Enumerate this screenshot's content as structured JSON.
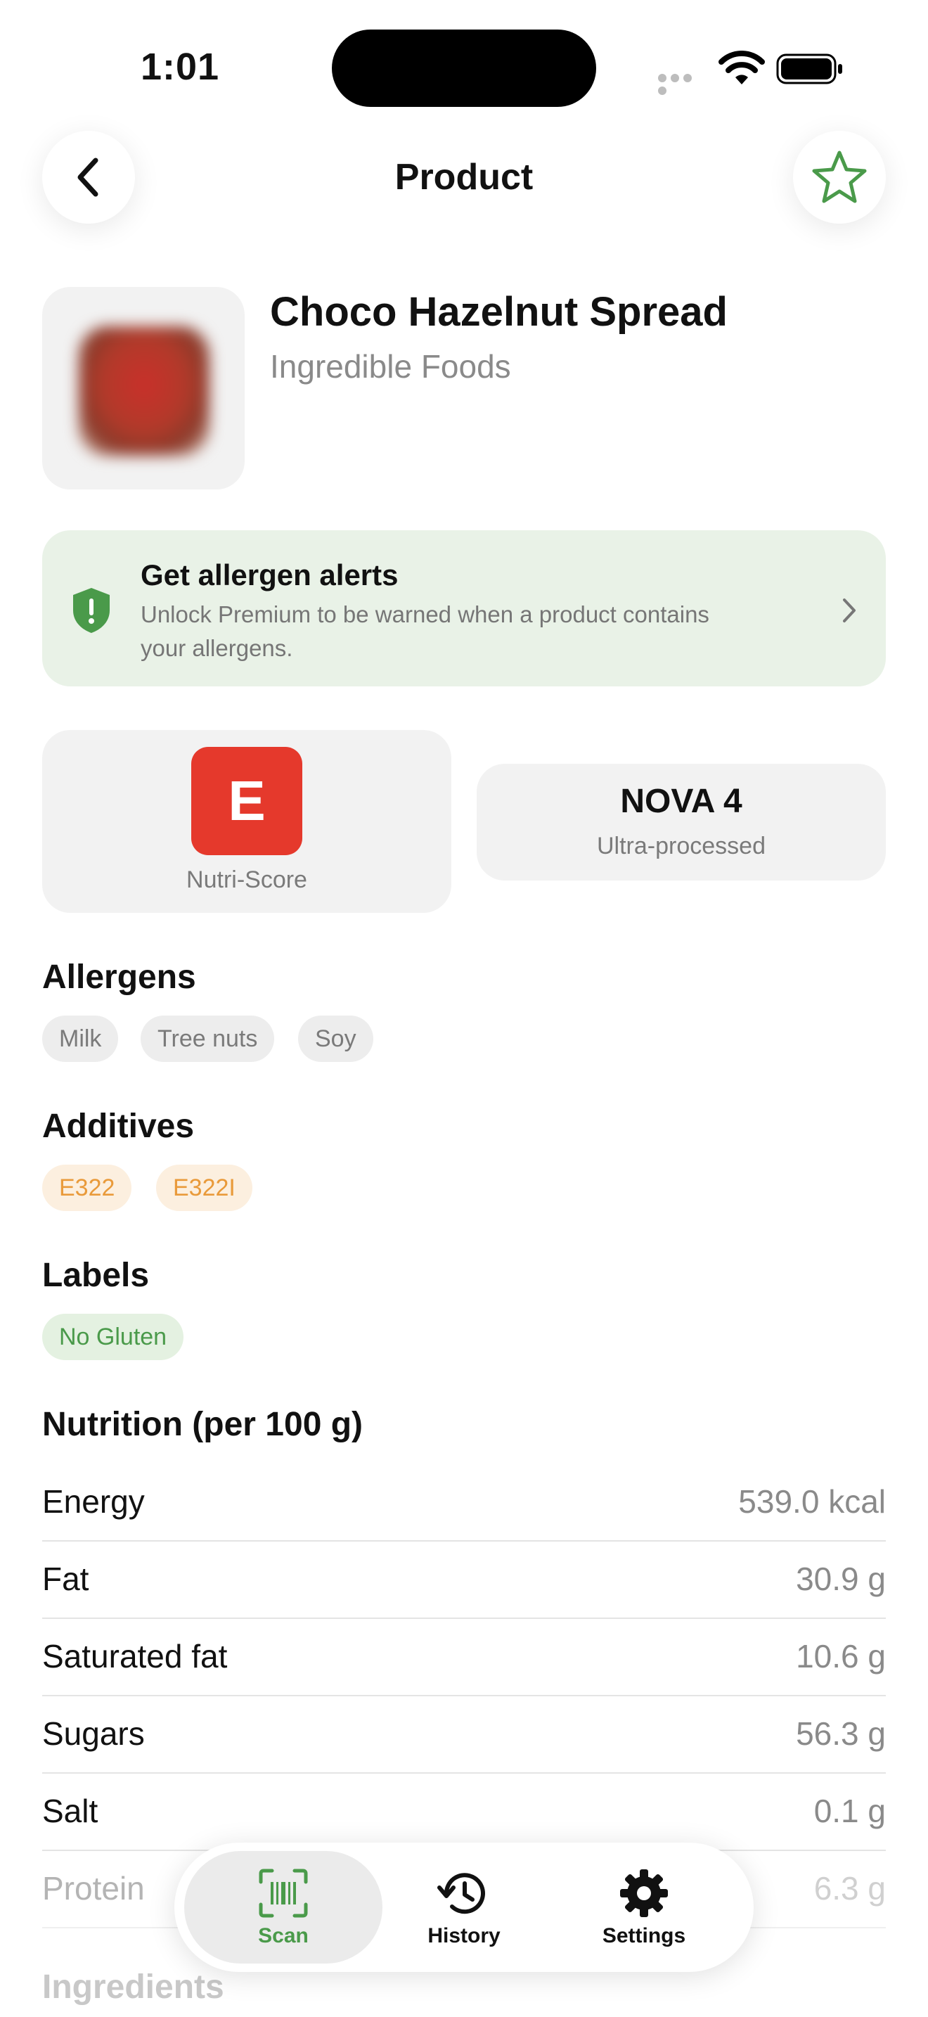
{
  "status_bar": {
    "time": "1:01"
  },
  "header": {
    "title": "Product"
  },
  "product": {
    "name": "Choco Hazelnut Spread",
    "brand": "Ingredible Foods"
  },
  "allergen_banner": {
    "title": "Get allergen alerts",
    "text": "Unlock Premium to be warned when a product contains your allergens."
  },
  "scores": {
    "nutri_grade": "E",
    "nutri_label": "Nutri-Score",
    "nutri_color": "#e5392c",
    "nova_title": "NOVA 4",
    "nova_sub": "Ultra-processed"
  },
  "allergens": {
    "title": "Allergens",
    "items": [
      "Milk",
      "Tree nuts",
      "Soy"
    ]
  },
  "additives": {
    "title": "Additives",
    "items": [
      "E322",
      "E322I"
    ]
  },
  "labels": {
    "title": "Labels",
    "items": [
      "No Gluten"
    ]
  },
  "nutrition": {
    "title": "Nutrition (per 100 g)",
    "rows": [
      {
        "name": "Energy",
        "value": "539.0 kcal"
      },
      {
        "name": "Fat",
        "value": "30.9 g"
      },
      {
        "name": "Saturated fat",
        "value": "10.6 g"
      },
      {
        "name": "Sugars",
        "value": "56.3 g"
      },
      {
        "name": "Salt",
        "value": "0.1 g"
      },
      {
        "name": "Protein",
        "value": "6.3 g"
      }
    ]
  },
  "ingredients": {
    "title": "Ingredients"
  },
  "tabs": [
    {
      "label": "Scan",
      "icon": "barcode-scan-icon",
      "active": true
    },
    {
      "label": "History",
      "icon": "history-icon",
      "active": false
    },
    {
      "label": "Settings",
      "icon": "gear-icon",
      "active": false
    }
  ],
  "colors": {
    "accent": "#4a9a4a",
    "banner_bg": "#e9f2e7"
  }
}
